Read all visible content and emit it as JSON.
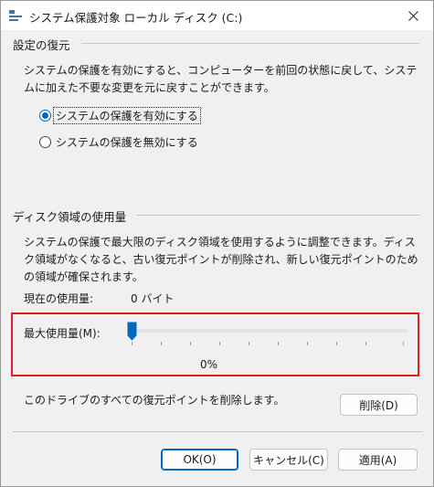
{
  "window": {
    "title": "システム保護対象 ローカル ディスク (C:)"
  },
  "restore": {
    "group_title": "設定の復元",
    "description": "システムの保護を有効にすると、コンピューターを前回の状態に戻して、システムに加えた不要な変更を元に戻すことができます。",
    "options": [
      {
        "label": "システムの保護を有効にする",
        "selected": true
      },
      {
        "label": "システムの保護を無効にする",
        "selected": false
      }
    ]
  },
  "disk": {
    "group_title": "ディスク領域の使用量",
    "description": "システムの保護で最大限のディスク領域を使用するように調整できます。ディスク領域がなくなると、古い復元ポイントが削除され、新しい復元ポイントのための領域が確保されます。",
    "current_usage_label": "現在の使用量:",
    "current_usage_value": "0 バイト",
    "max_usage_label": "最大使用量(M):",
    "max_usage_percent": "0%",
    "max_usage_fraction": 0,
    "delete_text": "このドライブのすべての復元ポイントを削除します。",
    "delete_button": "削除(D)"
  },
  "footer": {
    "ok_button": "OK(O)",
    "cancel_button": "キャンセル(C)",
    "apply_button": "適用(A)"
  },
  "colors": {
    "accent": "#0067c0",
    "highlight": "#e01e1e"
  },
  "icons": {
    "app": "system-properties-icon",
    "close": "close-icon",
    "slider": "slider-thumb"
  }
}
